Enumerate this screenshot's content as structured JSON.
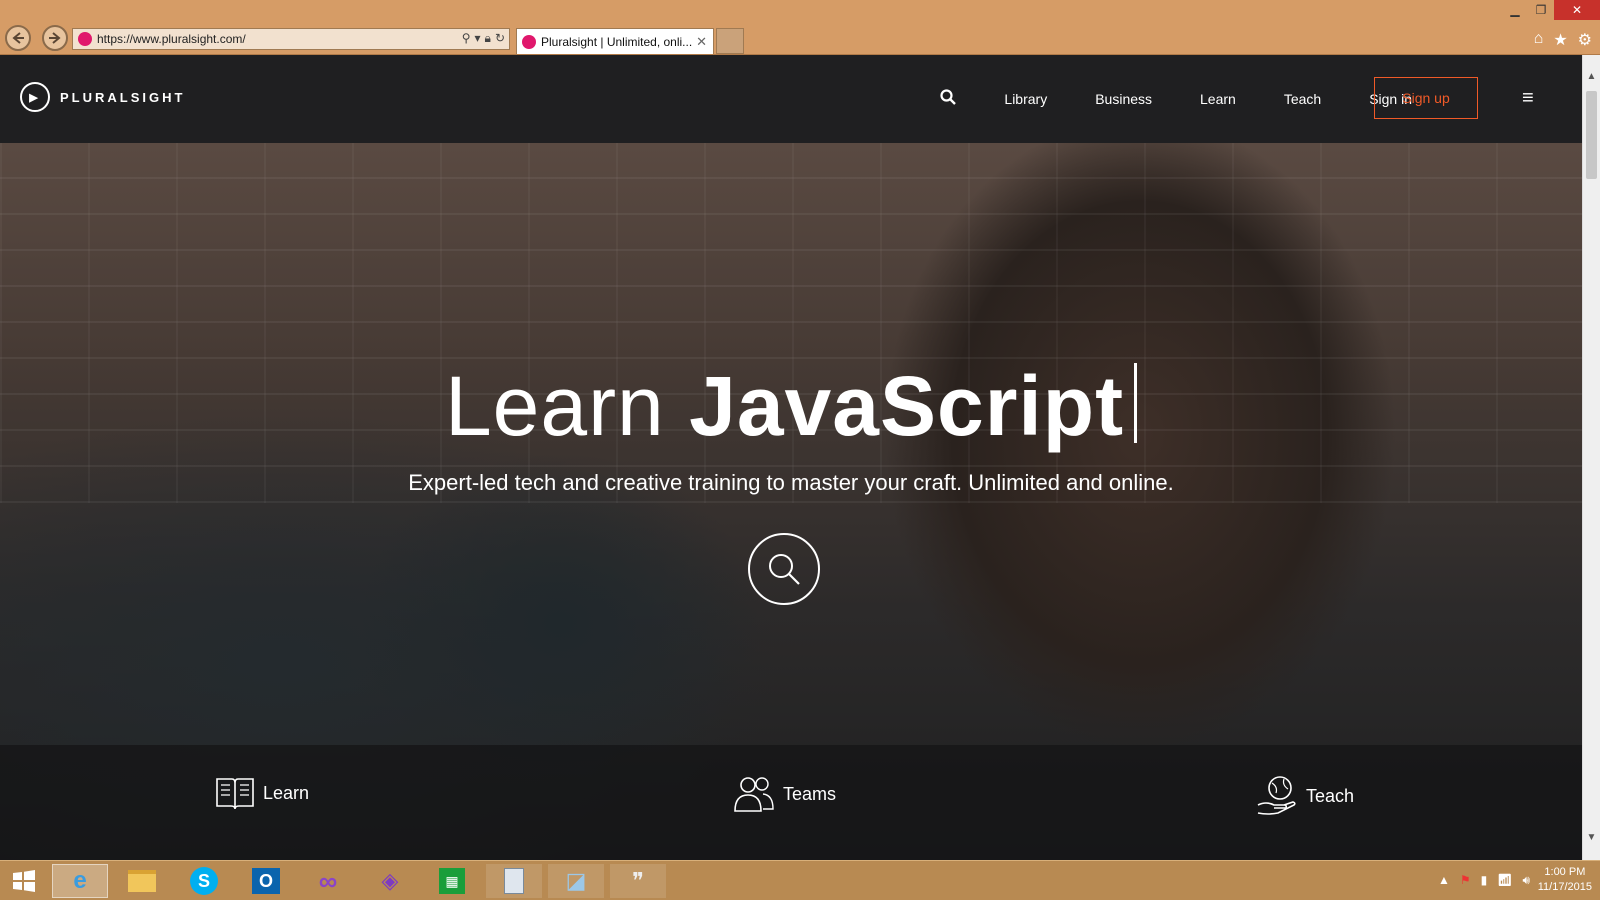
{
  "browser": {
    "url": "https://www.pluralsight.com/",
    "tab_title": "Pluralsight | Unlimited, onli...",
    "close_glyph": "✕"
  },
  "header": {
    "logo_text": "PLURALSIGHT",
    "nav": [
      "Library",
      "Business",
      "Learn",
      "Teach",
      "Sign in"
    ],
    "signup_label": "Sign up"
  },
  "hero": {
    "headline_light": "Learn",
    "headline_bold": "JavaScript",
    "subhead": "Expert-led tech and creative training to master your craft. Unlimited and online."
  },
  "features": {
    "learn": "Learn",
    "teams": "Teams",
    "teach": "Teach"
  },
  "taskbar": {
    "time": "1:00 PM",
    "date": "11/17/2015"
  },
  "colors": {
    "accent": "#f05a28",
    "nav_bg": "#1f1f21",
    "chrome_bg": "#d69c66"
  }
}
